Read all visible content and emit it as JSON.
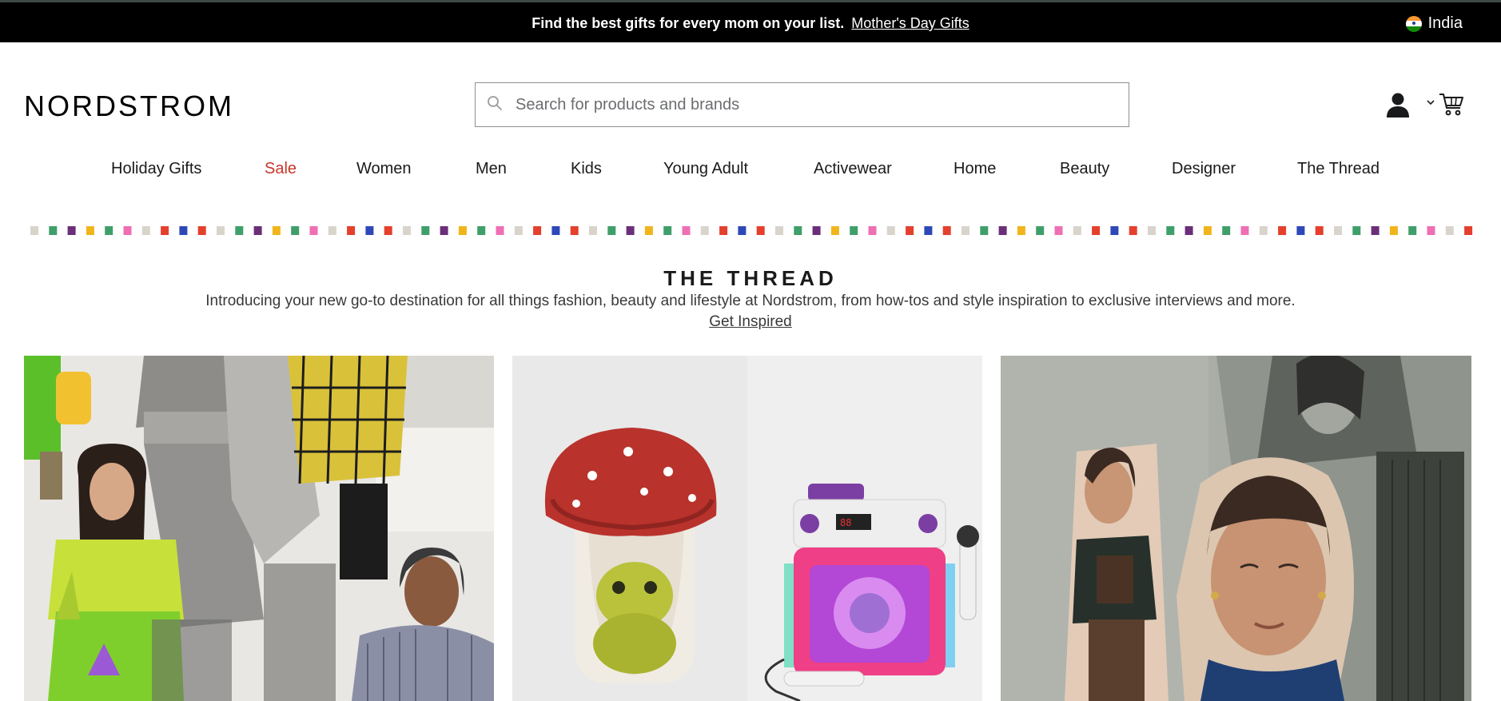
{
  "promo": {
    "text": "Find the best gifts for every mom on your list.",
    "link": "Mother's Day Gifts",
    "country": "India"
  },
  "header": {
    "logo": "NORDSTROM",
    "search_placeholder": "Search for products and brands"
  },
  "nav": {
    "items": [
      "Holiday Gifts",
      "Sale",
      "Women",
      "Men",
      "Kids",
      "Young Adult",
      "Activewear",
      "Home",
      "Beauty",
      "Designer",
      "The Thread"
    ],
    "sale_color": "#c8352b"
  },
  "confetti_colors": [
    "#d8d4cc",
    "#3f9f6b",
    "#6b2f7a",
    "#f1b51c",
    "#3f9f6b",
    "#ef6fb3",
    "#d8d4cc",
    "#e4402d",
    "#2f48b8",
    "#e4402d"
  ],
  "thread": {
    "title": "THE THREAD",
    "description": "Introducing your new go-to destination for all things fashion, beauty and lifestyle at Nordstrom, from how-tos and style inspiration to exclusive interviews and more.",
    "link": "Get Inspired"
  },
  "icons": [
    "search-icon",
    "account-icon",
    "chevron-down-icon",
    "cart-icon",
    "india-flag-icon"
  ]
}
